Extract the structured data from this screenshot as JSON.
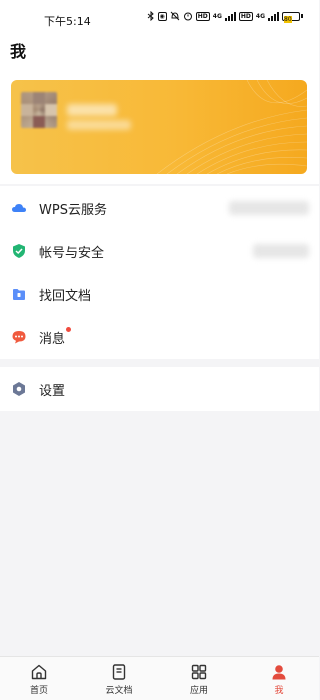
{
  "status_bar": {
    "time": "下午5:14",
    "network_labels": [
      "4G",
      "4G"
    ],
    "battery_level": "80"
  },
  "header": {
    "title": "我"
  },
  "menu": {
    "items": [
      {
        "label": "WPS云服务",
        "icon": "cloud-icon",
        "color": "#3e82f7"
      },
      {
        "label": "帐号与安全",
        "icon": "shield-check-icon",
        "color": "#22b573"
      },
      {
        "label": "找回文档",
        "icon": "folder-recover-icon",
        "color": "#5b8ff9"
      },
      {
        "label": "消息",
        "icon": "chat-bubble-icon",
        "color": "#f05a3e",
        "has_badge": true
      }
    ],
    "settings": {
      "label": "设置",
      "icon": "settings-hex-icon",
      "color": "#6c7896"
    }
  },
  "bottom_nav": {
    "items": [
      {
        "label": "首页",
        "icon": "home-icon"
      },
      {
        "label": "云文档",
        "icon": "document-icon"
      },
      {
        "label": "应用",
        "icon": "apps-grid-icon"
      },
      {
        "label": "我",
        "icon": "person-icon",
        "active": true
      }
    ]
  },
  "colors": {
    "accent": "#e34b3d",
    "card_gradient_start": "#f6c24a",
    "card_gradient_end": "#f5a91f"
  }
}
